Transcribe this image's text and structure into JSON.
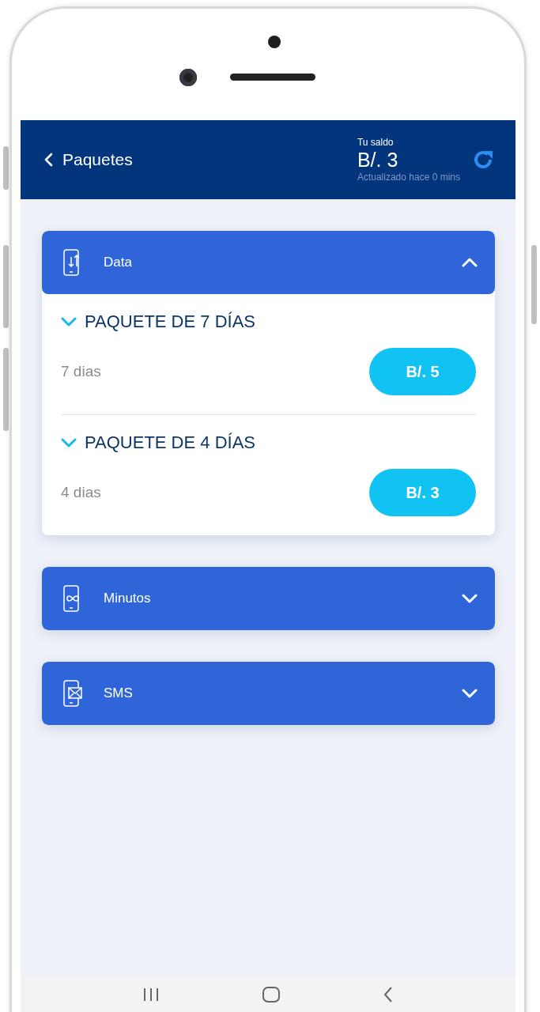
{
  "header": {
    "title": "Paquetes",
    "balance_label": "Tu saldo",
    "balance": "B/. 3",
    "updated": "Actualizado hace 0 mins"
  },
  "categories": [
    {
      "kind": "data",
      "label": "Data",
      "expanded": true,
      "packages": [
        {
          "title": "PAQUETE DE 7 DÍAS",
          "expanded": false,
          "duration": "7 dias",
          "price": "B/. 5"
        },
        {
          "title": "PAQUETE DE 4 DÍAS",
          "expanded": false,
          "duration": "4 dias",
          "price": "B/. 3"
        }
      ]
    },
    {
      "kind": "minutes",
      "label": "Minutos",
      "expanded": false
    },
    {
      "kind": "sms",
      "label": "SMS",
      "expanded": false
    }
  ]
}
